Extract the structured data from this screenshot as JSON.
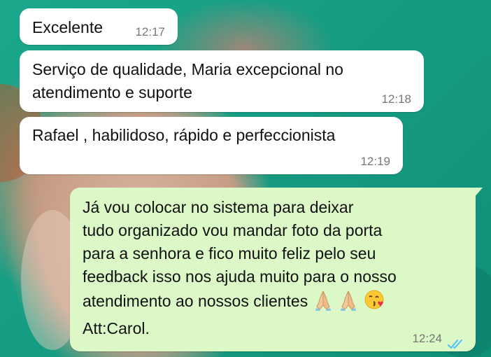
{
  "chat": {
    "messages": [
      {
        "direction": "incoming",
        "text": "Excelente",
        "time": "12:17"
      },
      {
        "direction": "incoming",
        "text": "Serviço de qualidade, Maria excepcional no\natendimento e suporte",
        "time": "12:18"
      },
      {
        "direction": "incoming",
        "text": "Rafael , habilidoso, rápido e perfeccionista",
        "time": "12:19"
      },
      {
        "direction": "outgoing",
        "text": "Já vou colocar no sistema para deixar\ntudo organizado vou mandar foto da porta\npara a senhora e fico muito feliz pelo seu\nfeedback isso nos ajuda muito para o nosso\natendimento ao nossos clientes",
        "emojis": [
          "folded-hands",
          "folded-hands",
          "face-blowing-kiss"
        ],
        "signature": "Att:Carol.",
        "time": "12:24",
        "status": "read-double-check"
      }
    ]
  },
  "colors": {
    "incoming_bubble": "#ffffff",
    "outgoing_bubble": "#dcf8c6",
    "read_tick": "#4fc3f7",
    "wallpaper_green": "#17a48a"
  }
}
